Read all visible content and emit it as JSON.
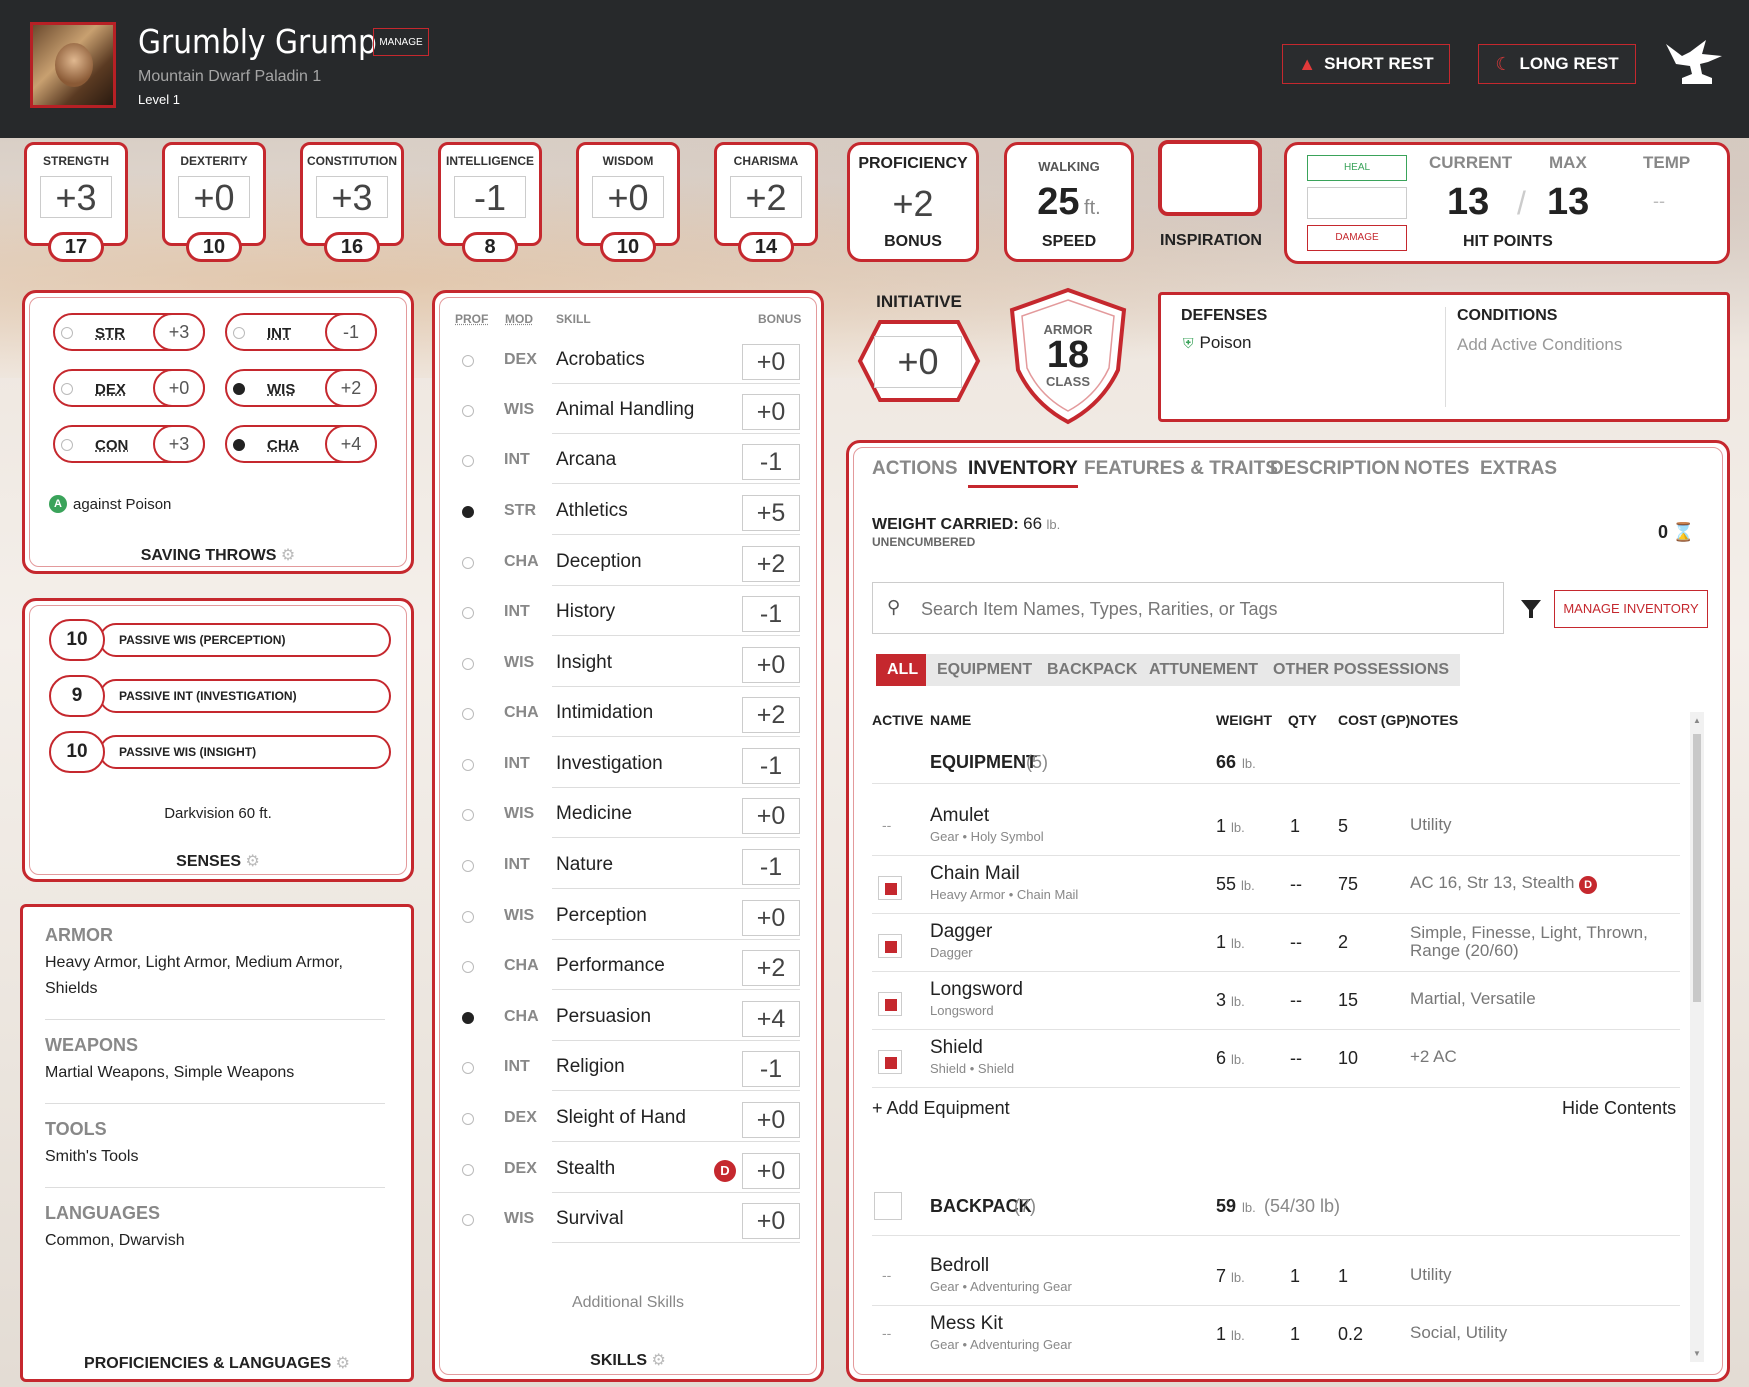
{
  "header": {
    "name": "Grumbly Grump",
    "manage_label": "MANAGE",
    "race_class": "Mountain Dwarf  Paladin 1",
    "level": "Level 1",
    "short_rest": "SHORT REST",
    "long_rest": "LONG REST"
  },
  "abilities": [
    {
      "name": "STRENGTH",
      "mod": "+3",
      "score": "17"
    },
    {
      "name": "DEXTERITY",
      "mod": "+0",
      "score": "10"
    },
    {
      "name": "CONSTITUTION",
      "mod": "+3",
      "score": "16"
    },
    {
      "name": "INTELLIGENCE",
      "mod": "-1",
      "score": "8"
    },
    {
      "name": "WISDOM",
      "mod": "+0",
      "score": "10"
    },
    {
      "name": "CHARISMA",
      "mod": "+2",
      "score": "14"
    }
  ],
  "proficiency": {
    "label": "PROFICIENCY",
    "value": "+2",
    "sublabel": "BONUS"
  },
  "speed": {
    "label": "WALKING",
    "value": "25",
    "unit": "ft.",
    "sublabel": "SPEED"
  },
  "inspiration": {
    "label": "INSPIRATION"
  },
  "hp": {
    "heal": "HEAL",
    "damage": "DAMAGE",
    "current_label": "CURRENT",
    "max_label": "MAX",
    "temp_label": "TEMP",
    "current": "13",
    "slash": "/",
    "max": "13",
    "temp": "--",
    "title": "HIT POINTS"
  },
  "saving_throws": {
    "title": "SAVING THROWS",
    "note": "against Poison",
    "items": [
      {
        "ab": "STR",
        "val": "+3",
        "prof": false
      },
      {
        "ab": "INT",
        "val": "-1",
        "prof": false
      },
      {
        "ab": "DEX",
        "val": "+0",
        "prof": false
      },
      {
        "ab": "WIS",
        "val": "+2",
        "prof": true
      },
      {
        "ab": "CON",
        "val": "+3",
        "prof": false
      },
      {
        "ab": "CHA",
        "val": "+4",
        "prof": true
      }
    ]
  },
  "senses": {
    "title": "SENSES",
    "passives": [
      {
        "val": "10",
        "label": "PASSIVE WIS (PERCEPTION)"
      },
      {
        "val": "9",
        "label": "PASSIVE INT (INVESTIGATION)"
      },
      {
        "val": "10",
        "label": "PASSIVE WIS (INSIGHT)"
      }
    ],
    "extra": "Darkvision 60 ft."
  },
  "proficiencies": {
    "title": "PROFICIENCIES & LANGUAGES",
    "groups": [
      {
        "head": "ARMOR",
        "text": "Heavy Armor, Light Armor, Medium Armor, Shields"
      },
      {
        "head": "WEAPONS",
        "text": "Martial Weapons, Simple Weapons"
      },
      {
        "head": "TOOLS",
        "text": "Smith's Tools"
      },
      {
        "head": "LANGUAGES",
        "text": "Common, Dwarvish"
      }
    ]
  },
  "skills": {
    "title": "SKILLS",
    "headers": {
      "prof": "PROF",
      "mod": "MOD",
      "skill": "SKILL",
      "bonus": "BONUS"
    },
    "additional": "Additional Skills",
    "disadvantage_letter": "D",
    "items": [
      {
        "mod": "DEX",
        "name": "Acrobatics",
        "bonus": "+0",
        "prof": false
      },
      {
        "mod": "WIS",
        "name": "Animal Handling",
        "bonus": "+0",
        "prof": false
      },
      {
        "mod": "INT",
        "name": "Arcana",
        "bonus": "-1",
        "prof": false
      },
      {
        "mod": "STR",
        "name": "Athletics",
        "bonus": "+5",
        "prof": true
      },
      {
        "mod": "CHA",
        "name": "Deception",
        "bonus": "+2",
        "prof": false
      },
      {
        "mod": "INT",
        "name": "History",
        "bonus": "-1",
        "prof": false
      },
      {
        "mod": "WIS",
        "name": "Insight",
        "bonus": "+0",
        "prof": false
      },
      {
        "mod": "CHA",
        "name": "Intimidation",
        "bonus": "+2",
        "prof": false
      },
      {
        "mod": "INT",
        "name": "Investigation",
        "bonus": "-1",
        "prof": false
      },
      {
        "mod": "WIS",
        "name": "Medicine",
        "bonus": "+0",
        "prof": false
      },
      {
        "mod": "INT",
        "name": "Nature",
        "bonus": "-1",
        "prof": false
      },
      {
        "mod": "WIS",
        "name": "Perception",
        "bonus": "+0",
        "prof": false
      },
      {
        "mod": "CHA",
        "name": "Performance",
        "bonus": "+2",
        "prof": false
      },
      {
        "mod": "CHA",
        "name": "Persuasion",
        "bonus": "+4",
        "prof": true
      },
      {
        "mod": "INT",
        "name": "Religion",
        "bonus": "-1",
        "prof": false
      },
      {
        "mod": "DEX",
        "name": "Sleight of Hand",
        "bonus": "+0",
        "prof": false
      },
      {
        "mod": "DEX",
        "name": "Stealth",
        "bonus": "+0",
        "prof": false,
        "disadvantage": true
      },
      {
        "mod": "WIS",
        "name": "Survival",
        "bonus": "+0",
        "prof": false
      }
    ]
  },
  "initiative": {
    "label": "INITIATIVE",
    "value": "+0"
  },
  "armor_class": {
    "top": "ARMOR",
    "value": "18",
    "bottom": "CLASS"
  },
  "defenses": {
    "title": "DEFENSES",
    "item": "Poison"
  },
  "conditions": {
    "title": "CONDITIONS",
    "placeholder": "Add Active Conditions"
  },
  "tabs": [
    "ACTIONS",
    "INVENTORY",
    "FEATURES & TRAITS",
    "DESCRIPTION",
    "NOTES",
    "EXTRAS"
  ],
  "inventory": {
    "weight_label": "WEIGHT CARRIED:",
    "weight_value": "66",
    "weight_unit": "lb.",
    "encumbrance": "UNENCUMBERED",
    "currency": "0",
    "search_placeholder": "Search Item Names, Types, Rarities, or Tags",
    "manage_label": "MANAGE INVENTORY",
    "filters": [
      "ALL",
      "EQUIPMENT",
      "BACKPACK",
      "ATTUNEMENT",
      "OTHER POSSESSIONS"
    ],
    "columns": {
      "active": "ACTIVE",
      "name": "NAME",
      "weight": "WEIGHT",
      "qty": "QTY",
      "cost": "COST (GP)",
      "notes": "NOTES"
    },
    "equipment": {
      "title": "EQUIPMENT",
      "count": "(5)",
      "weight": "66",
      "unit": "lb.",
      "items": [
        {
          "active": "--",
          "name": "Amulet",
          "sub": "Gear • Holy Symbol",
          "weight": "1",
          "qty": "1",
          "cost": "5",
          "notes": "Utility"
        },
        {
          "active": "on",
          "name": "Chain Mail",
          "sub": "Heavy Armor • Chain Mail",
          "weight": "55",
          "qty": "--",
          "cost": "75",
          "notes": "AC 16, Str 13, Stealth"
        },
        {
          "active": "on",
          "name": "Dagger",
          "sub": "Dagger",
          "weight": "1",
          "qty": "--",
          "cost": "2",
          "notes": "Simple, Finesse, Light, Thrown, Range (20/60)"
        },
        {
          "active": "on",
          "name": "Longsword",
          "sub": "Longsword",
          "weight": "3",
          "qty": "--",
          "cost": "15",
          "notes": "Martial, Versatile"
        },
        {
          "active": "on",
          "name": "Shield",
          "sub": "Shield • Shield",
          "weight": "6",
          "qty": "--",
          "cost": "10",
          "notes": "+2 AC"
        }
      ],
      "add_label": "+ Add Equipment",
      "hide_label": "Hide Contents"
    },
    "backpack": {
      "title": "BACKPACK",
      "count": "(7)",
      "weight": "59",
      "unit": "lb.",
      "capacity": "(54/30 lb)",
      "items": [
        {
          "active": "--",
          "name": "Bedroll",
          "sub": "Gear • Adventuring Gear",
          "weight": "7",
          "qty": "1",
          "cost": "1",
          "notes": "Utility"
        },
        {
          "active": "--",
          "name": "Mess Kit",
          "sub": "Gear • Adventuring Gear",
          "weight": "1",
          "qty": "1",
          "cost": "0.2",
          "notes": "Social, Utility"
        }
      ]
    }
  },
  "colors": {
    "accent": "#c5282e",
    "topbar": "#27292b",
    "text": "#222222"
  }
}
